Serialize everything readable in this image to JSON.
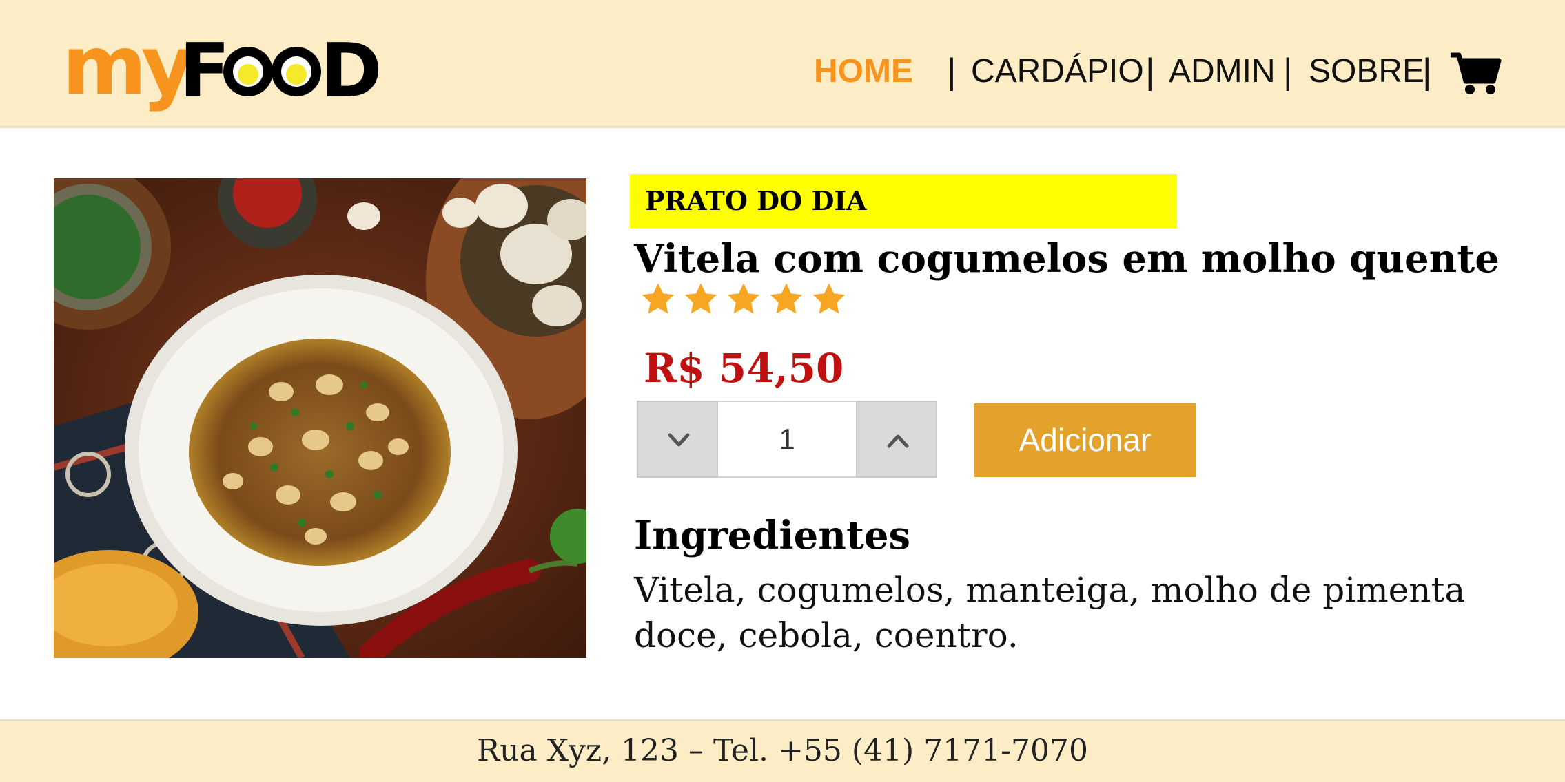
{
  "brand": {
    "logo_prefix": "my",
    "logo_suffix": "FOOD",
    "colors": {
      "orange": "#f7941d",
      "yellow": "#f5e92b",
      "header_bg": "#fcedc6"
    }
  },
  "nav": {
    "items": [
      {
        "label": "HOME",
        "active": true
      },
      {
        "label": "CARDÁPIO",
        "active": false
      },
      {
        "label": "ADMIN",
        "active": false
      },
      {
        "label": "SOBRE",
        "active": false
      }
    ],
    "separator": "|",
    "cart_icon": "shopping-cart-icon"
  },
  "dish": {
    "photo_alt": "dish-photo",
    "badge": "PRATO DO DIA",
    "name": "Vitela com cogumelos em molho quente",
    "rating": 5,
    "rating_max": 5,
    "price": "R$ 54,50",
    "price_color": "#c0100f",
    "quantity": "1",
    "decrease_icon": "chevron-down-icon",
    "increase_icon": "chevron-up-icon",
    "add_button": "Adicionar",
    "add_button_color": "#e2a22b",
    "ingredients_title": "Ingredientes",
    "ingredients_line1": "Vitela, cogumelos, manteiga, molho de pimenta",
    "ingredients_line2": "doce, cebola, coentro."
  },
  "footer": {
    "text": "Rua Xyz, 123 – Tel. +55 (41) 7171-7070"
  }
}
